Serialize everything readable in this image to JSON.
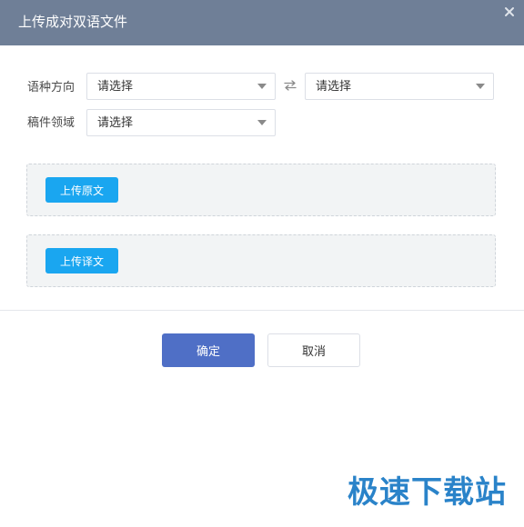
{
  "dialog": {
    "title": "上传成对双语文件",
    "close_icon": "close-icon"
  },
  "form": {
    "language_direction_label": "语种方向",
    "source_select_value": "请选择",
    "target_select_value": "请选择",
    "swap_icon": "swap-icon",
    "domain_label": "稿件领域",
    "domain_select_value": "请选择"
  },
  "uploads": {
    "original_label": "上传原文",
    "translation_label": "上传译文"
  },
  "footer": {
    "confirm_label": "确定",
    "cancel_label": "取消"
  },
  "watermark": "极速下载站",
  "colors": {
    "header": "#6f7f97",
    "upload_button": "#1aa6f0",
    "confirm_button": "#4f6fc6",
    "watermark": "#2a83c9"
  }
}
